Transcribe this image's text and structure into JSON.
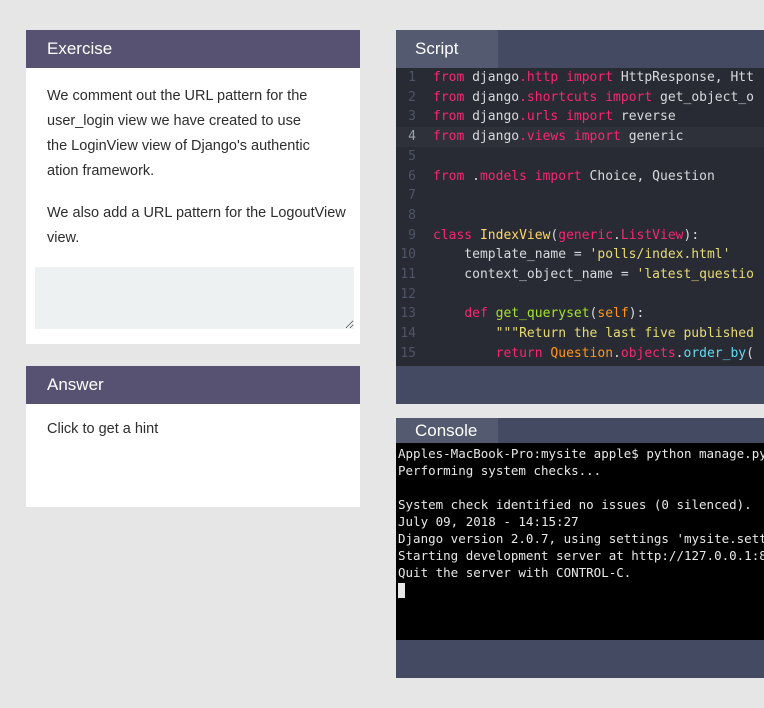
{
  "exercise": {
    "title": "Exercise",
    "para1_lines": [
      "We comment out the URL pattern for the",
      "user_login view we have created  to use",
      "the LoginView view of Django's authentic",
      "ation framework."
    ],
    "para2_lines": [
      "We also add a URL pattern for the  LogoutView",
      "view."
    ],
    "input_value": ""
  },
  "answer": {
    "title": "Answer",
    "hint": "Click to get a hint"
  },
  "script": {
    "title": "Script",
    "line_numbers": [
      "1",
      "2",
      "3",
      "4",
      "5",
      "6",
      "7",
      "8",
      "9",
      "10",
      "11",
      "12",
      "13",
      "14",
      "15"
    ],
    "code": {
      "l1": [
        "from",
        " django",
        ".http",
        " import",
        " HttpResponse, Htt"
      ],
      "l2": [
        "from",
        " django",
        ".shortcuts",
        " import",
        " get_object_o"
      ],
      "l3": [
        "from",
        " django",
        ".urls",
        " import",
        " reverse"
      ],
      "l4": [
        "from",
        " django",
        ".views",
        " import",
        " generic"
      ],
      "l6": [
        "from",
        " .",
        "models",
        " import",
        " Choice, Question"
      ],
      "l9": [
        "class",
        " IndexView",
        "(",
        "generic",
        ".",
        "ListView",
        "):"
      ],
      "l10": [
        "    template_name = ",
        "'polls/index.html'"
      ],
      "l11": [
        "    context_object_name = ",
        "'latest_questio"
      ],
      "l13": [
        "    ",
        "def",
        " get_queryset",
        "(",
        "self",
        "):"
      ],
      "l14": [
        "        ",
        "\"\"\"Return the last five published"
      ],
      "l15": [
        "        ",
        "return",
        " Question",
        ".",
        "objects",
        ".",
        "order_by",
        "("
      ]
    }
  },
  "console": {
    "title": "Console",
    "lines": [
      "Apples-MacBook-Pro:mysite apple$ python manage.py",
      "Performing system checks...",
      "",
      "System check identified no issues (0 silenced).",
      "July 09, 2018 - 14:15:27",
      "Django version 2.0.7, using settings 'mysite.sett",
      "Starting development server at http://127.0.0.1:8",
      "Quit the server with CONTROL-C."
    ]
  }
}
